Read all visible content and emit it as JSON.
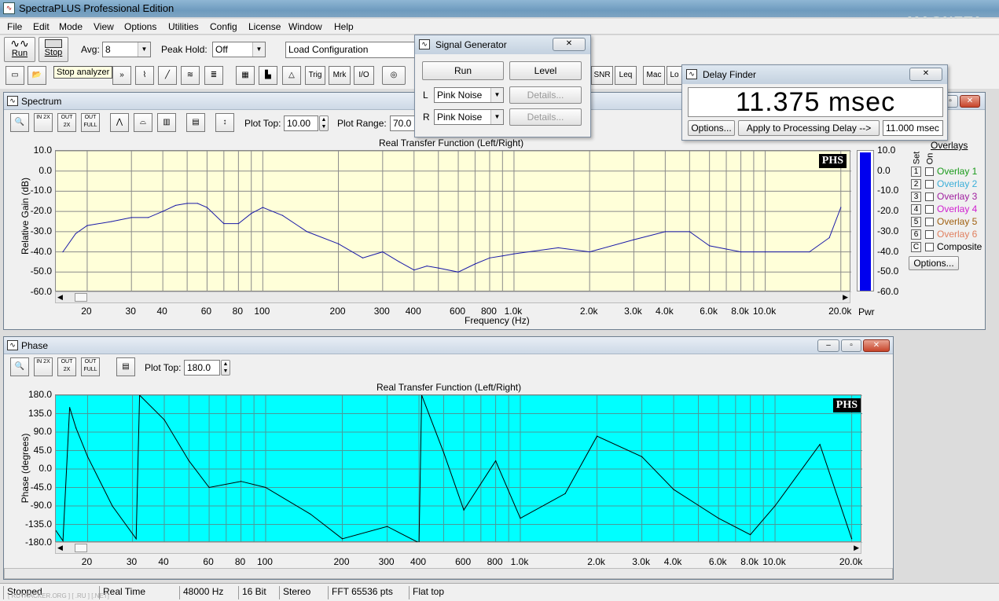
{
  "app": {
    "title": "SpectraPLUS Professional Edition",
    "watermark": "MAGNETA"
  },
  "menu": [
    "File",
    "Edit",
    "Mode",
    "View",
    "Options",
    "Utilities",
    "Config",
    "License",
    "Window",
    "Help"
  ],
  "toolbar": {
    "run": "Run",
    "stop": "Stop",
    "avg_label": "Avg:",
    "avg_value": "8",
    "peak_label": "Peak Hold:",
    "peak_value": "Off",
    "load_config": "Load Configuration",
    "tooltip": "Stop analyzer",
    "text_buttons": [
      "Trig",
      "Mrk",
      "I/O",
      "SNR",
      "Leq",
      "Mac",
      "Lo"
    ]
  },
  "spectrum": {
    "title": "Spectrum",
    "plot_top_label": "Plot Top:",
    "plot_top": "10.00",
    "plot_range_label": "Plot Range:",
    "plot_range": "70.0",
    "chart_title": "Real Transfer Function (Left/Right)",
    "ylabel": "Relative Gain (dB)",
    "xlabel": "Frequency (Hz)",
    "yticks": [
      "10.0",
      "0.0",
      "-10.0",
      "-20.0",
      "-30.0",
      "-40.0",
      "-50.0",
      "-60.0"
    ],
    "xticks": [
      "20",
      "30",
      "40",
      "60",
      "80",
      "100",
      "200",
      "300",
      "400",
      "600",
      "800",
      "1.0k",
      "2.0k",
      "3.0k",
      "4.0k",
      "6.0k",
      "8.0k",
      "10.0k",
      "20.0k"
    ],
    "pwr_ticks": [
      "10.0",
      "0.0",
      "-10.0",
      "-20.0",
      "-30.0",
      "-40.0",
      "-50.0",
      "-60.0"
    ],
    "pwr_label": "Pwr",
    "badge": "PHS",
    "zoom_labels": [
      "IN 2X",
      "OUT 2X",
      "OUT FULL"
    ]
  },
  "overlays": {
    "title": "Overlays",
    "set": "Set",
    "on": "On",
    "options": "Options...",
    "items": [
      {
        "num": "1",
        "label": "Overlay 1",
        "color": "#1a9a1a"
      },
      {
        "num": "2",
        "label": "Overlay 2",
        "color": "#3aaed8"
      },
      {
        "num": "3",
        "label": "Overlay 3",
        "color": "#a020a0"
      },
      {
        "num": "4",
        "label": "Overlay 4",
        "color": "#d020d0"
      },
      {
        "num": "5",
        "label": "Overlay 5",
        "color": "#a06010"
      },
      {
        "num": "6",
        "label": "Overlay 6",
        "color": "#e08060"
      },
      {
        "num": "C",
        "label": "Composite",
        "color": "#000000"
      }
    ]
  },
  "phase": {
    "title": "Phase",
    "plot_top_label": "Plot Top:",
    "plot_top": "180.0",
    "chart_title": "Real Transfer Function (Left/Right)",
    "ylabel": "Phase (degrees)",
    "badge": "PHS",
    "yticks": [
      "180.0",
      "135.0",
      "90.0",
      "45.0",
      "0.0",
      "-45.0",
      "-90.0",
      "-135.0",
      "-180.0"
    ],
    "xticks": [
      "20",
      "30",
      "40",
      "60",
      "80",
      "100",
      "200",
      "300",
      "400",
      "600",
      "800",
      "1.0k",
      "2.0k",
      "3.0k",
      "4.0k",
      "6.0k",
      "8.0k",
      "10.0k",
      "20.0k"
    ]
  },
  "signal_gen": {
    "title": "Signal Generator",
    "run": "Run",
    "level": "Level",
    "l": "L",
    "r": "R",
    "l_val": "Pink Noise",
    "r_val": "Pink Noise",
    "details": "Details..."
  },
  "delay": {
    "title": "Delay Finder",
    "value": "11.375 msec",
    "options": "Options...",
    "apply": "Apply to Processing Delay -->",
    "delay_val": "11.000 msec"
  },
  "status": [
    "Stopped",
    "Real Time",
    "48000 Hz",
    "16 Bit",
    "Stereo",
    "FFT 65536 pts",
    "Flat top"
  ],
  "status_watermark": "[ RUTRACKER.ORG ] [ .RU ] [.NET]",
  "chart_data": [
    {
      "type": "line",
      "title": "Real Transfer Function (Left/Right)",
      "xlabel": "Frequency (Hz)",
      "ylabel": "Relative Gain (dB)",
      "xscale": "log",
      "xlim": [
        15,
        22000
      ],
      "ylim": [
        -60,
        10
      ],
      "series": [
        {
          "x": [
            16,
            18,
            20,
            25,
            30,
            35,
            40,
            45,
            50,
            55,
            60,
            70,
            80,
            90,
            100,
            120,
            150,
            200,
            250,
            300,
            350,
            400,
            450,
            500,
            600,
            700,
            800,
            900,
            1000,
            1500,
            2000,
            3000,
            4000,
            5000,
            6000,
            8000,
            10000,
            15000,
            18000,
            20000
          ],
          "y": [
            -40,
            -31,
            -27,
            -25,
            -23,
            -23,
            -20,
            -17,
            -16,
            -16,
            -18,
            -26,
            -26,
            -21,
            -18,
            -22,
            -30,
            -36,
            -43,
            -40,
            -45,
            -49,
            -47,
            -48,
            -50,
            -46,
            -43,
            -42,
            -41,
            -38,
            -40,
            -34,
            -30,
            -30,
            -37,
            -40,
            -40,
            -40,
            -33,
            -18
          ]
        }
      ]
    },
    {
      "type": "line",
      "title": "Real Transfer Function (Left/Right)",
      "ylabel": "Phase (degrees)",
      "xscale": "log",
      "xlim": [
        15,
        22000
      ],
      "ylim": [
        -180,
        180
      ],
      "series": [
        {
          "x": [
            15,
            16,
            17,
            18,
            20,
            25,
            31,
            32,
            40,
            50,
            60,
            80,
            100,
            150,
            200,
            300,
            400,
            410,
            500,
            600,
            800,
            1000,
            1500,
            2000,
            3000,
            4000,
            6000,
            8000,
            10000,
            15000,
            20000
          ],
          "y": [
            -150,
            -175,
            150,
            100,
            30,
            -90,
            -170,
            180,
            120,
            20,
            -45,
            -30,
            -45,
            -110,
            -170,
            -140,
            -180,
            180,
            40,
            -100,
            20,
            -120,
            -60,
            80,
            30,
            -50,
            -120,
            -160,
            -90,
            60,
            -170
          ]
        }
      ]
    }
  ]
}
